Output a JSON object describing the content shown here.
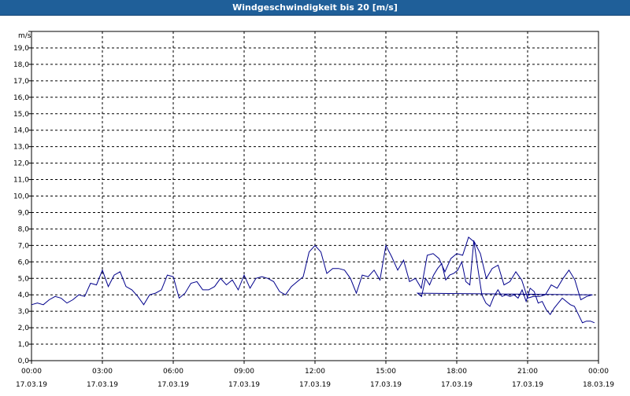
{
  "window": {
    "title": "Windgeschwindigkeit bis 20 [m/s]"
  },
  "chart_data": {
    "type": "line",
    "title": "Windgeschwindigkeit bis 20 [m/s]",
    "ylabel": "m/s",
    "xlabel": "",
    "ylim": [
      0,
      20
    ],
    "yticks": [
      "0,0",
      "1,0",
      "2,0",
      "3,0",
      "4,0",
      "5,0",
      "6,0",
      "7,0",
      "8,0",
      "9,0",
      "10,0",
      "11,0",
      "12,0",
      "13,0",
      "14,0",
      "15,0",
      "16,0",
      "17,0",
      "18,0",
      "19,0"
    ],
    "xticks": [
      {
        "time": "00:00",
        "date": "17.03.19"
      },
      {
        "time": "03:00",
        "date": "17.03.19"
      },
      {
        "time": "06:00",
        "date": "17.03.19"
      },
      {
        "time": "09:00",
        "date": "17.03.19"
      },
      {
        "time": "12:00",
        "date": "17.03.19"
      },
      {
        "time": "15:00",
        "date": "17.03.19"
      },
      {
        "time": "18:00",
        "date": "17.03.19"
      },
      {
        "time": "21:00",
        "date": "17.03.19"
      },
      {
        "time": "00:00",
        "date": "18.03.19"
      }
    ],
    "grid": true,
    "color": "#00008b",
    "series": [
      {
        "x_hours": [
          0,
          0.25,
          0.5,
          0.75,
          1,
          1.25,
          1.5,
          1.75,
          2,
          2.25,
          2.5,
          2.75,
          3,
          3.25,
          3.5,
          3.75,
          4,
          4.25,
          4.5,
          4.75,
          5,
          5.25,
          5.5,
          5.75,
          6,
          6.25,
          6.5,
          6.75,
          7,
          7.25,
          7.5,
          7.75,
          8,
          8.25,
          8.5,
          8.75,
          9,
          9.25,
          9.5,
          9.75,
          10,
          10.25,
          10.5,
          10.75,
          11,
          11.25,
          11.5,
          11.75,
          12,
          12.25,
          12.5,
          12.75,
          13,
          13.25,
          13.5,
          13.75,
          14,
          14.25,
          14.5,
          14.75,
          15,
          15.25,
          15.5,
          15.75,
          16,
          16.25,
          16.5,
          16.75,
          17,
          17.25,
          17.5,
          17.75,
          18,
          18.25,
          18.5,
          18.75,
          19,
          19.25,
          19.5,
          19.75,
          20,
          20.25,
          20.5,
          20.75,
          21,
          21.25,
          21.5,
          21.75,
          22,
          22.25,
          22.5,
          22.75,
          23,
          23.25,
          23.5,
          23.75
        ],
        "values": [
          3.4,
          3.5,
          3.4,
          3.7,
          3.9,
          3.8,
          3.5,
          3.7,
          4.0,
          3.9,
          4.7,
          4.6,
          5.5,
          4.5,
          5.2,
          5.4,
          4.5,
          4.3,
          3.9,
          3.4,
          4.0,
          4.1,
          4.3,
          5.2,
          5.1,
          3.8,
          4.1,
          4.7,
          4.8,
          4.3,
          4.3,
          4.5,
          5.0,
          4.6,
          4.9,
          4.3,
          5.2,
          4.4,
          5.0,
          5.1,
          5.0,
          4.8,
          4.2,
          4.0,
          4.5,
          4.8,
          5.1,
          6.6,
          7.0,
          6.6,
          5.3,
          5.6,
          5.6,
          5.5,
          5.0,
          4.1,
          5.2,
          5.1,
          5.5,
          4.9,
          7.0,
          6.3,
          5.5,
          6.1,
          4.8,
          5.0,
          4.4,
          6.4,
          6.5,
          6.2,
          5.4,
          6.2,
          6.5,
          6.4,
          7.5,
          7.2,
          6.5,
          5.0,
          5.6,
          5.8,
          4.6,
          4.8,
          5.4,
          4.9,
          3.8,
          3.9,
          3.9,
          4.0,
          4.6,
          4.4,
          5.0,
          5.5,
          4.9,
          3.7,
          3.9,
          4.0,
          4.1,
          3.9,
          5.0,
          4.6,
          5.2,
          5.6,
          5.9,
          4.9,
          5.2,
          5.3,
          5.5,
          6.0,
          4.8,
          4.6,
          7.3,
          5.6,
          4.0,
          3.5,
          3.3,
          3.9,
          4.3,
          3.9,
          4.0,
          3.9,
          4.0,
          3.8,
          4.3,
          3.6,
          4.4,
          4.2,
          3.5,
          3.6,
          3.1,
          2.8,
          3.2,
          3.5,
          3.8,
          3.6,
          3.4,
          3.3,
          2.8,
          2.3,
          2.4,
          2.4,
          2.3
        ]
      }
    ]
  }
}
